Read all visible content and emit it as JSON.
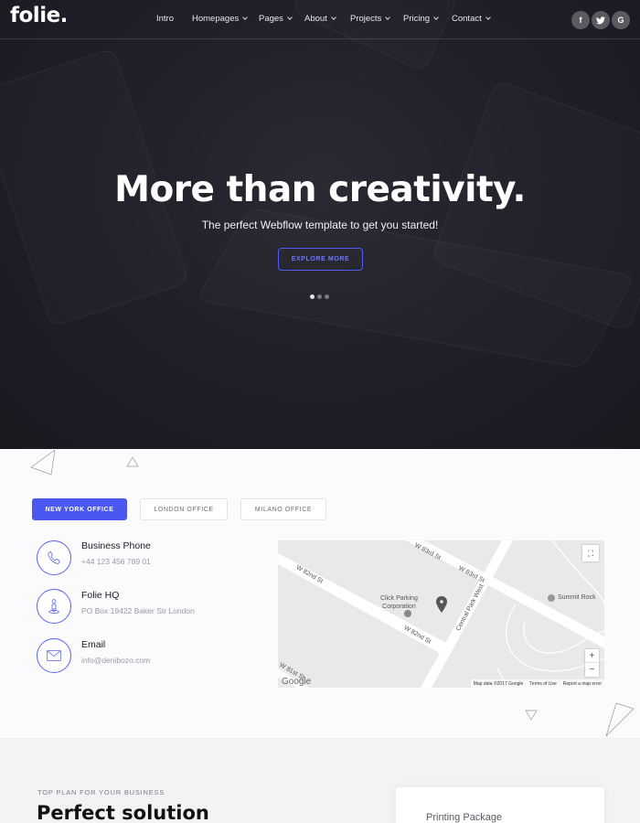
{
  "brand": {
    "logo": "folie."
  },
  "nav": {
    "items": [
      {
        "label": "Intro",
        "has_dropdown": false
      },
      {
        "label": "Homepages",
        "has_dropdown": true
      },
      {
        "label": "Pages",
        "has_dropdown": true
      },
      {
        "label": "About",
        "has_dropdown": true
      },
      {
        "label": "Projects",
        "has_dropdown": true
      },
      {
        "label": "Pricing",
        "has_dropdown": true
      },
      {
        "label": "Contact",
        "has_dropdown": true
      }
    ],
    "social": [
      {
        "icon": "facebook-icon",
        "glyph": "f"
      },
      {
        "icon": "twitter-icon",
        "glyph": "t"
      },
      {
        "icon": "google-icon",
        "glyph": "G"
      }
    ]
  },
  "hero": {
    "title": "More than creativity.",
    "subtitle": "The perfect Webflow template to get you started!",
    "button": "EXPLORE MORE",
    "slides": 3,
    "active_slide": 1
  },
  "contact": {
    "tabs": [
      {
        "label": "NEW YORK OFFICE",
        "active": true
      },
      {
        "label": "LONDON OFFICE",
        "active": false
      },
      {
        "label": "MILANO OFFICE",
        "active": false
      }
    ],
    "items": [
      {
        "icon": "phone-icon",
        "title": "Business Phone",
        "value": "+44 123 456 789 01"
      },
      {
        "icon": "person-pin-icon",
        "title": "Folie HQ",
        "value": "PO Box 19422 Baker Str London"
      },
      {
        "icon": "envelope-icon",
        "title": "Email",
        "value": "info@denibozo.com"
      }
    ],
    "map": {
      "streets": [
        "W 83rd St",
        "W 83rd St",
        "W 82nd St",
        "W 82nd St",
        "Central Park West",
        "W 81st St"
      ],
      "places": [
        "Click Parking Corporation",
        "Summit Rock"
      ],
      "place_line1": "Click Parking",
      "place_line2": "Corporation",
      "zoom_in": "+",
      "zoom_out": "−",
      "google": "Google",
      "footer": [
        "Map data ©2017 Google",
        "Terms of Use",
        "Report a map error"
      ]
    }
  },
  "plan": {
    "kicker": "TOP PLAN FOR YOUR BUSINESS",
    "title": "Perfect solution",
    "card_label": "Printing Package"
  },
  "colors": {
    "accent": "#4a57f1",
    "hero_bg": "#211f28",
    "social_bg": "#5a5a60"
  }
}
